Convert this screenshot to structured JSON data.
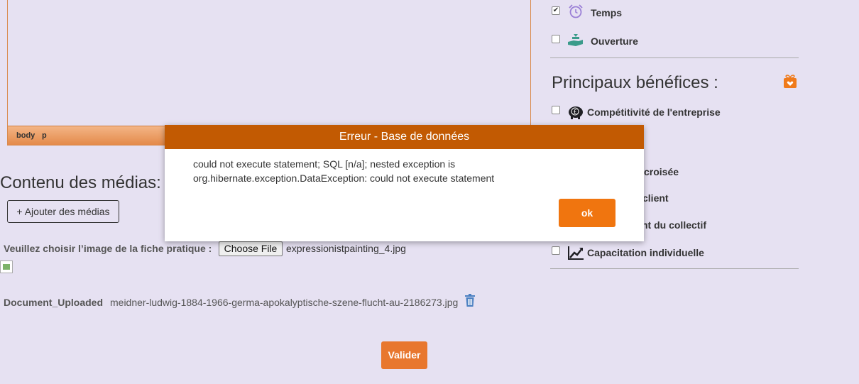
{
  "editor": {
    "status_path": [
      "body",
      "p"
    ]
  },
  "media": {
    "section_title": "Contenu des médias:",
    "add_button": "+ Ajouter des médias",
    "image_label": "Veuillez choisir l’image de la fiche pratique :",
    "choose_file_button": "Choose File",
    "chosen_file": "expressionistpainting_4.jpg",
    "document_label": "Document_Uploaded",
    "document_name": "meidner-ludwig-1884-1966-germa-apokalyptische-szene-flucht-au-2186273.jpg",
    "submit_button": "Valider"
  },
  "sidebar": {
    "top_items": [
      {
        "label": "Temps",
        "checked": true,
        "icon": "alarm-clock-icon"
      },
      {
        "label": "Ouverture",
        "checked": false,
        "icon": "hand-holding-icon"
      }
    ],
    "benefits_title": "Principaux bénéfices :",
    "benefits": [
      {
        "label": "Compétitivité de l'entreprise",
        "checked": false,
        "icon": "piggy-bank-icon"
      },
      {
        "label": "croisée",
        "checked": false
      },
      {
        "label": "client",
        "checked": false
      },
      {
        "label": "nt du collectif",
        "checked": false
      },
      {
        "label": "Capacitation individuelle",
        "checked": false,
        "icon": "trend-chart-icon"
      }
    ]
  },
  "dialog": {
    "title": "Erreur - Base de données",
    "message": "could not execute statement; SQL [n/a]; nested exception is org.hibernate.exception.DataException: could not execute statement",
    "ok_button": "ok"
  },
  "colors": {
    "background": "#e6e1f2",
    "dialog_header": "#c25a02",
    "primary_button": "#f0750f",
    "submit_button": "#e8772e",
    "icon_purple": "#9a7fd6",
    "icon_teal": "#3a9b8a"
  }
}
